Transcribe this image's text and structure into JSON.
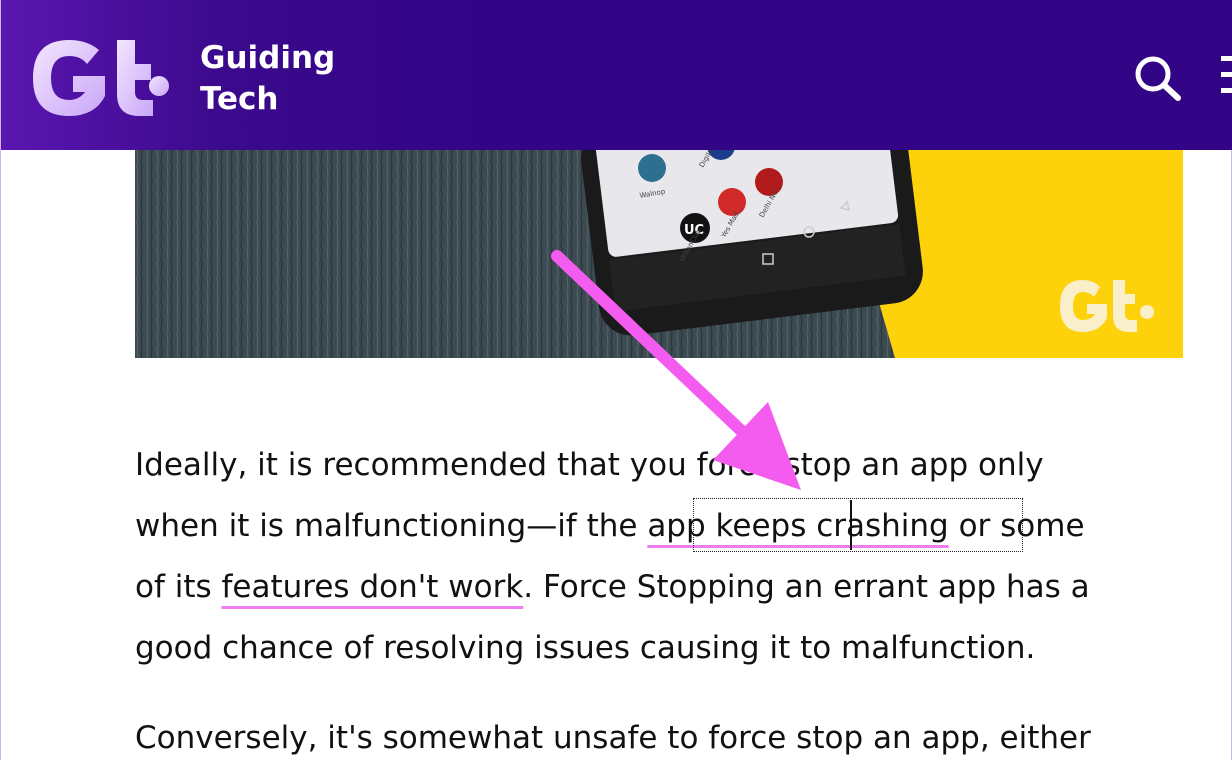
{
  "header": {
    "brand_line1": "Guiding",
    "brand_line2": "Tech",
    "colors": {
      "background": "#320486",
      "logo_text": "#ffffff"
    },
    "icons": [
      "gt-logo-icon",
      "search-icon",
      "hamburger-menu-icon"
    ]
  },
  "hero": {
    "phone_app_labels": [
      "Walnop",
      "DigiLocker",
      "UrbanClap",
      "Yes Mad...",
      "Delhi NC..."
    ],
    "phone_app_icon_text": "UC",
    "watermark_icon": "gt-watermark-icon",
    "colors": {
      "table": "#3a464d",
      "background": "#fdd20a"
    }
  },
  "article": {
    "p1_line1": "Ideally, it is recommended that you force stop an app only",
    "p1_line2_before": "when it is malfunctioning—if the ",
    "p1_line2_link": "app keeps crashing",
    "p1_line2_after": " or some",
    "p1_line3_before": "of its ",
    "p1_line3_link": "features don't work",
    "p1_line3_after": ". Force Stopping an errant app has a",
    "p1_line4": "good chance of resolving issues causing it to malfunction.",
    "p2_line1": "Conversely, it's somewhat unsafe to force stop an app, either"
  },
  "annotation": {
    "arrow_color": "#f45cf0",
    "icon": "pink-arrow-icon"
  }
}
